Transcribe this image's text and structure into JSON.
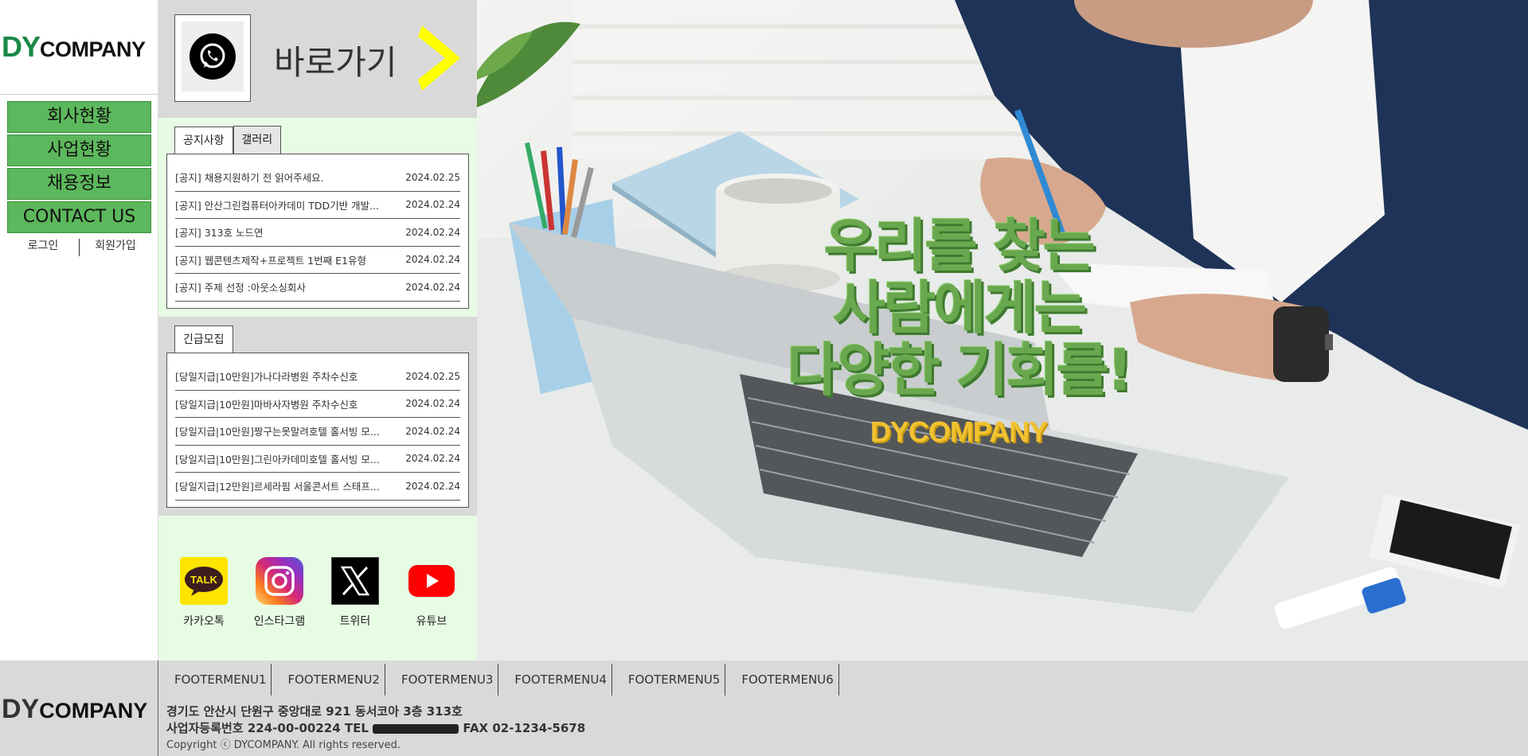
{
  "brand": {
    "logo_dy": "DY",
    "logo_company": "COMPANY"
  },
  "menu": [
    {
      "label": "회사현황"
    },
    {
      "label": "사업현황"
    },
    {
      "label": "채용정보"
    },
    {
      "label": "CONTACT US"
    }
  ],
  "auth": {
    "login": "로그인",
    "signup": "회원가입"
  },
  "shortcut": {
    "label": "바로가기",
    "icon": "whatsapp-icon",
    "arrow_color": "#ffff00"
  },
  "notice": {
    "tabs": [
      "공지사항",
      "갤러리"
    ],
    "items": [
      {
        "title": "[공지] 채용지원하기 전 읽어주세요.",
        "date": "2024.02.25"
      },
      {
        "title": "[공지] 안산그린컴퓨터아카데미 TDD기반 개발...",
        "date": "2024.02.24"
      },
      {
        "title": "[공지] 313호 노드연",
        "date": "2024.02.24"
      },
      {
        "title": "[공지] 웹콘텐츠제작+프로젝트 1번째 E1유형",
        "date": "2024.02.24"
      },
      {
        "title": "[공지] 주제 선정 :아웃소싱회사",
        "date": "2024.02.24"
      }
    ]
  },
  "urgent": {
    "tab": "긴급모집",
    "items": [
      {
        "title": "[당일지급|10만원]가나다라병원 주차수신호",
        "date": "2024.02.25"
      },
      {
        "title": "[당일지급|10만원]마바사자병원 주차수신호",
        "date": "2024.02.24"
      },
      {
        "title": "[당일지급|10만원]짱구는못말려호텔 홀서빙 모...",
        "date": "2024.02.24"
      },
      {
        "title": "[당일지급|10만원]그린아카데미호텔 홀서빙 모...",
        "date": "2024.02.24"
      },
      {
        "title": "[당일지급|12만원]르세라핌 서울콘서트 스태프...",
        "date": "2024.02.24"
      }
    ]
  },
  "social": [
    {
      "label": "카카오톡",
      "icon": "kakaotalk-icon",
      "icon_text": "TALK",
      "color": "#fee500"
    },
    {
      "label": "인스타그램",
      "icon": "instagram-icon",
      "color": "#d62976"
    },
    {
      "label": "트위터",
      "icon": "x-twitter-icon",
      "color": "#000000"
    },
    {
      "label": "유튜브",
      "icon": "youtube-icon",
      "color": "#ff0000"
    }
  ],
  "hero": {
    "lines": [
      "우리를 찾는",
      "사람에게는",
      "다양한 기회를!"
    ],
    "brand": "DYCOMPANY",
    "headline_color": "#6aa84f",
    "brand_color": "#f1c232"
  },
  "footer": {
    "menus": [
      "FOOTERMENU1",
      "FOOTERMENU2",
      "FOOTERMENU3",
      "FOOTERMENU4",
      "FOOTERMENU5",
      "FOOTERMENU6"
    ],
    "address": "경기도 안산시 단원구 중앙대로 921 동서코아 3층 313호",
    "biz_label": "사업자등록번호",
    "biz_number": "224-00-00224",
    "tel_label": "TEL",
    "fax": "FAX 02-1234-5678",
    "copyright": "Copyright ⓒ DYCOMPANY. All rights reserved."
  }
}
